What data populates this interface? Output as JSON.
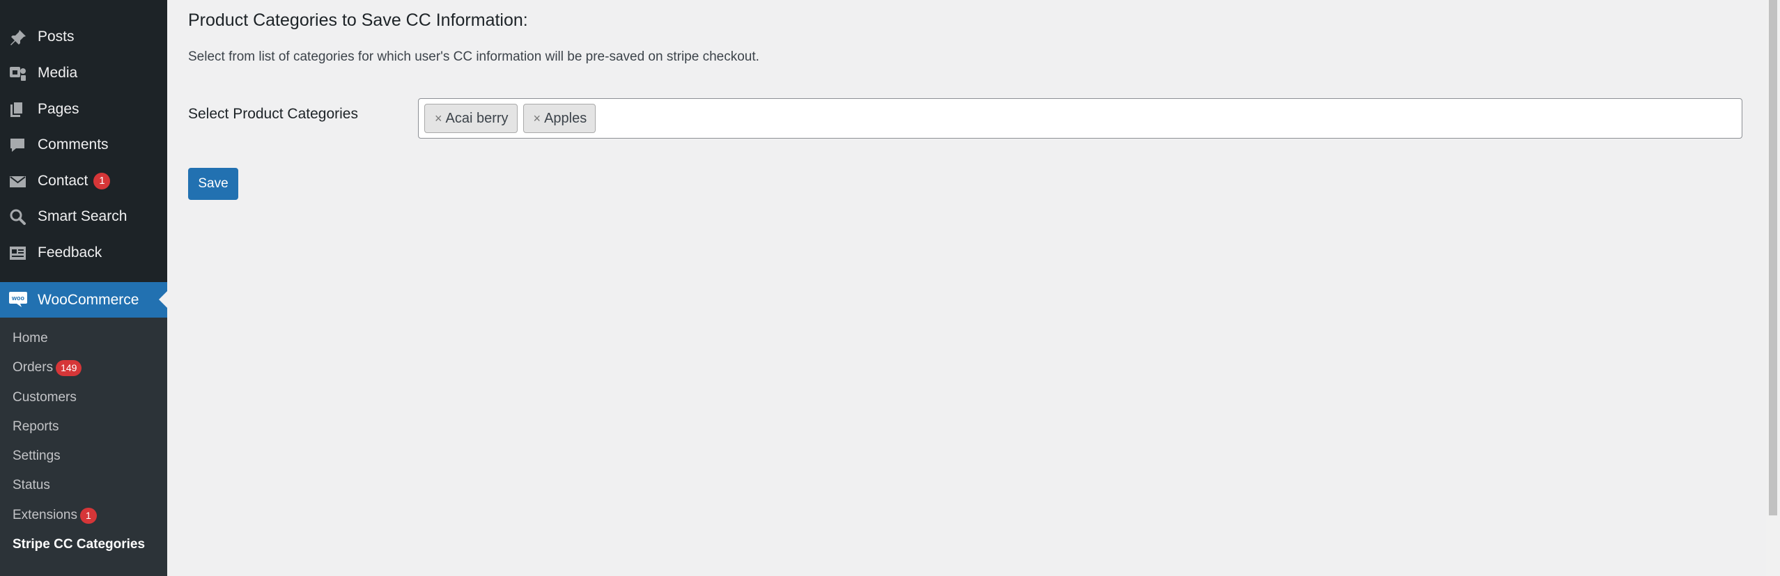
{
  "sidebar": {
    "items": [
      {
        "label": "Posts",
        "icon": "pin-icon"
      },
      {
        "label": "Media",
        "icon": "media-icon"
      },
      {
        "label": "Pages",
        "icon": "pages-icon"
      },
      {
        "label": "Comments",
        "icon": "comment-icon"
      },
      {
        "label": "Contact",
        "icon": "mail-icon",
        "badge": "1"
      },
      {
        "label": "Smart Search",
        "icon": "search-icon"
      },
      {
        "label": "Feedback",
        "icon": "feedback-icon"
      }
    ],
    "woocommerce": {
      "label": "WooCommerce",
      "logo_text": "woo"
    },
    "submenu": [
      {
        "label": "Home"
      },
      {
        "label": "Orders",
        "badge": "149"
      },
      {
        "label": "Customers"
      },
      {
        "label": "Reports"
      },
      {
        "label": "Settings"
      },
      {
        "label": "Status"
      },
      {
        "label": "Extensions",
        "badge": "1"
      },
      {
        "label": "Stripe CC Categories",
        "current": true
      }
    ]
  },
  "main": {
    "title": "Product Categories to Save CC Information:",
    "description": "Select from list of categories for which user's CC information will be pre-saved on stripe checkout.",
    "field_label": "Select Product Categories",
    "selected_categories": [
      {
        "label": "Acai berry",
        "remove_glyph": "×"
      },
      {
        "label": "Apples",
        "remove_glyph": "×"
      }
    ],
    "save_label": "Save"
  },
  "colors": {
    "sidebar_bg": "#1d2327",
    "submenu_bg": "#2c3338",
    "accent": "#2271b1",
    "badge": "#d63638",
    "page_bg": "#f0f0f1"
  }
}
